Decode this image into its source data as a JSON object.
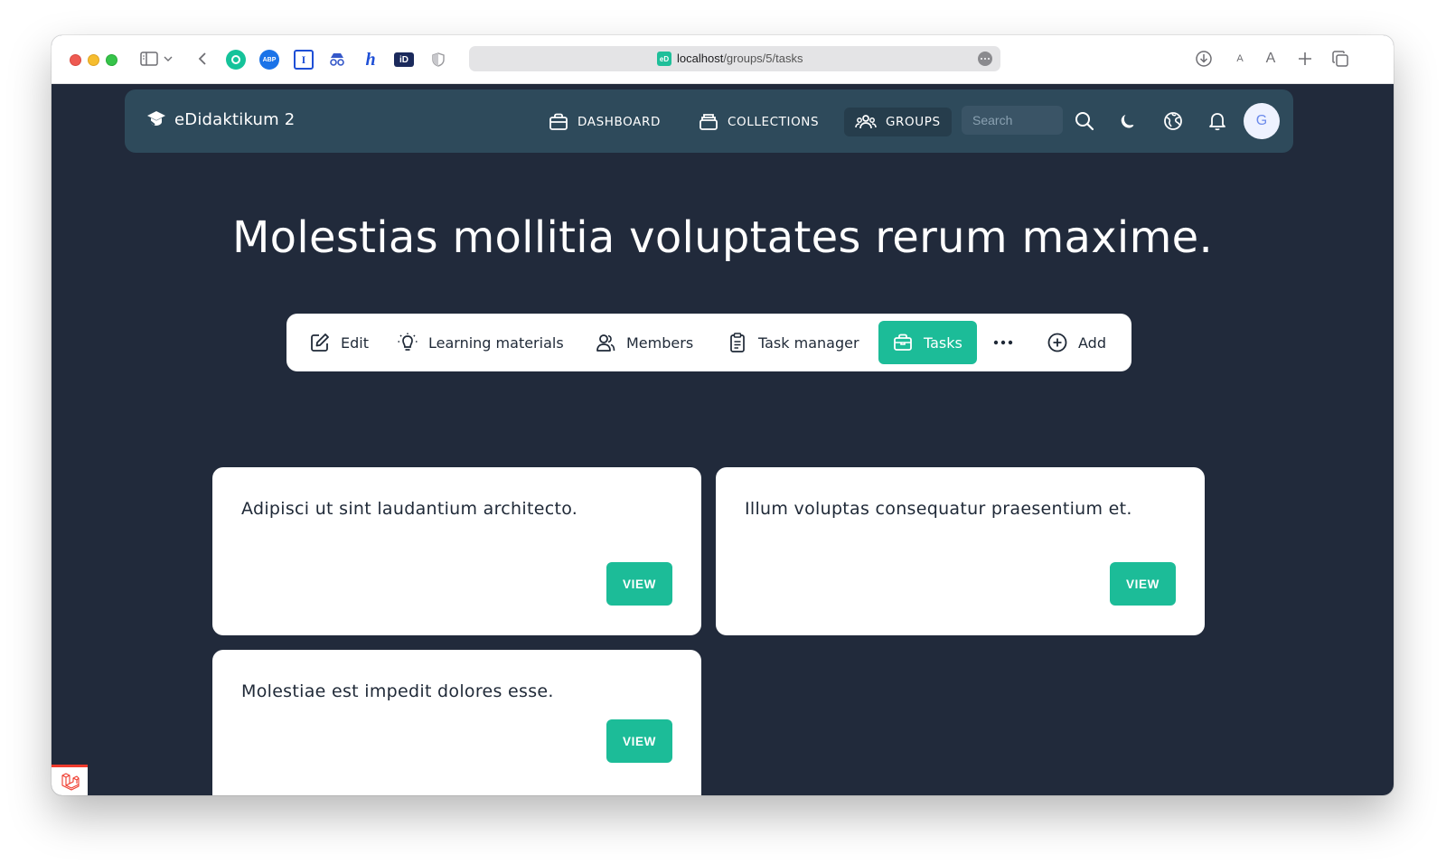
{
  "browser": {
    "url_host": "localhost",
    "url_path": "/groups/5/tasks",
    "favicon_text": "eD",
    "extensions": [
      {
        "name": "grammarly-icon",
        "color": "#15c39a",
        "label": "G"
      },
      {
        "name": "adblock-plus-icon",
        "color": "#1a73e8",
        "label": "ABP"
      },
      {
        "name": "instapaper-icon",
        "color": "#1e4fd6",
        "label": "I"
      },
      {
        "name": "spy-icon",
        "color": "#3558c9",
        "label": ""
      },
      {
        "name": "hypothesis-icon",
        "color": "#1e4fd6",
        "label": "h"
      },
      {
        "name": "id-icon",
        "color": "#1b2a5c",
        "label": "iD"
      },
      {
        "name": "shield-icon",
        "color": "#b5b5b5",
        "label": ""
      }
    ],
    "text_size_small": "A",
    "text_size_large": "A"
  },
  "nav": {
    "brand": "eDidaktikum 2",
    "links": [
      {
        "label": "DASHBOARD",
        "icon": "briefcase-icon"
      },
      {
        "label": "COLLECTIONS",
        "icon": "archive-icon"
      },
      {
        "label": "GROUPS",
        "icon": "users-icon",
        "active": true
      }
    ],
    "search_placeholder": "Search",
    "avatar_initial": "G"
  },
  "page": {
    "title": "Molestias mollitia voluptates rerum maxime."
  },
  "tabs": [
    {
      "label": "Edit",
      "icon": "edit-icon"
    },
    {
      "label": "Learning materials",
      "icon": "lightbulb-icon"
    },
    {
      "label": "Members",
      "icon": "members-icon"
    },
    {
      "label": "Task manager",
      "icon": "clipboard-icon"
    },
    {
      "label": "Tasks",
      "icon": "briefcase-icon",
      "active": true
    },
    {
      "label": "",
      "icon": "more-horizontal-icon"
    },
    {
      "label": "Add",
      "icon": "plus-circle-icon"
    }
  ],
  "tasks": [
    {
      "title": "Adipisci ut sint laudantium architecto.",
      "button": "VIEW"
    },
    {
      "title": "Illum voluptas consequatur praesentium et.",
      "button": "VIEW"
    },
    {
      "title": "Molestiae est impedit dolores esse.",
      "button": "VIEW"
    }
  ],
  "colors": {
    "page_bg": "#212a3b",
    "nav_bg": "#2e4a5b",
    "accent": "#1cbc98",
    "laravel_red": "#ef3b2d"
  }
}
